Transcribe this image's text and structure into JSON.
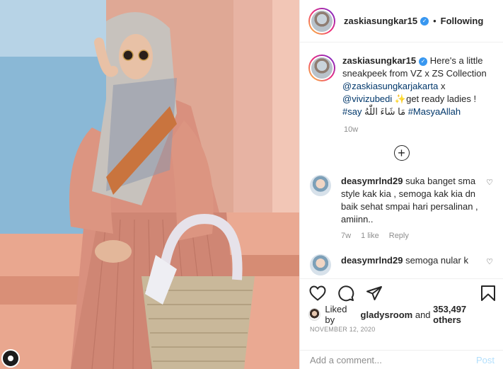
{
  "post": {
    "username": "zaskiasungkar15",
    "follow_status": "Following",
    "caption": {
      "username": "zaskiasungkar15",
      "text_1": "Here's a little sneakpeek from VZ x ZS Collection",
      "mention_1": "@zaskiasungkarjakarta",
      "x": "x",
      "mention_2": "@vivizubedi",
      "text_2": "get ready ladies !",
      "hashtag_1": "#say",
      "arabic": "مَا شَاءَ اللّٰهُ",
      "hashtag_2": "#MasyaAllah",
      "time": "10w"
    },
    "comments": [
      {
        "username": "deasymrlnd29",
        "text": "suka banget sma style kak kia , semoga kak kia dn baik sehat smpai hari persalinan , amiinn..",
        "time": "7w",
        "likes": "1 like",
        "reply": "Reply"
      },
      {
        "username": "deasymrlnd29",
        "text": "semoga nular k"
      }
    ],
    "likes": {
      "prefix": "Liked by",
      "user": "gladysroom",
      "and": "and",
      "count": "353,497 others"
    },
    "date": "NOVEMBER 12, 2020",
    "comment_input": {
      "placeholder": "Add a comment..."
    },
    "post_button": "Post"
  },
  "icons": {
    "verified": "verified-badge-icon",
    "load_more": "plus-circle-icon",
    "like": "heart-icon",
    "comment": "comment-icon",
    "share": "paper-plane-icon",
    "save": "bookmark-icon"
  },
  "colors": {
    "link": "#00376b",
    "verified": "#3897f0",
    "muted": "#8e8e8e",
    "post_disabled": "#b2dffc"
  }
}
